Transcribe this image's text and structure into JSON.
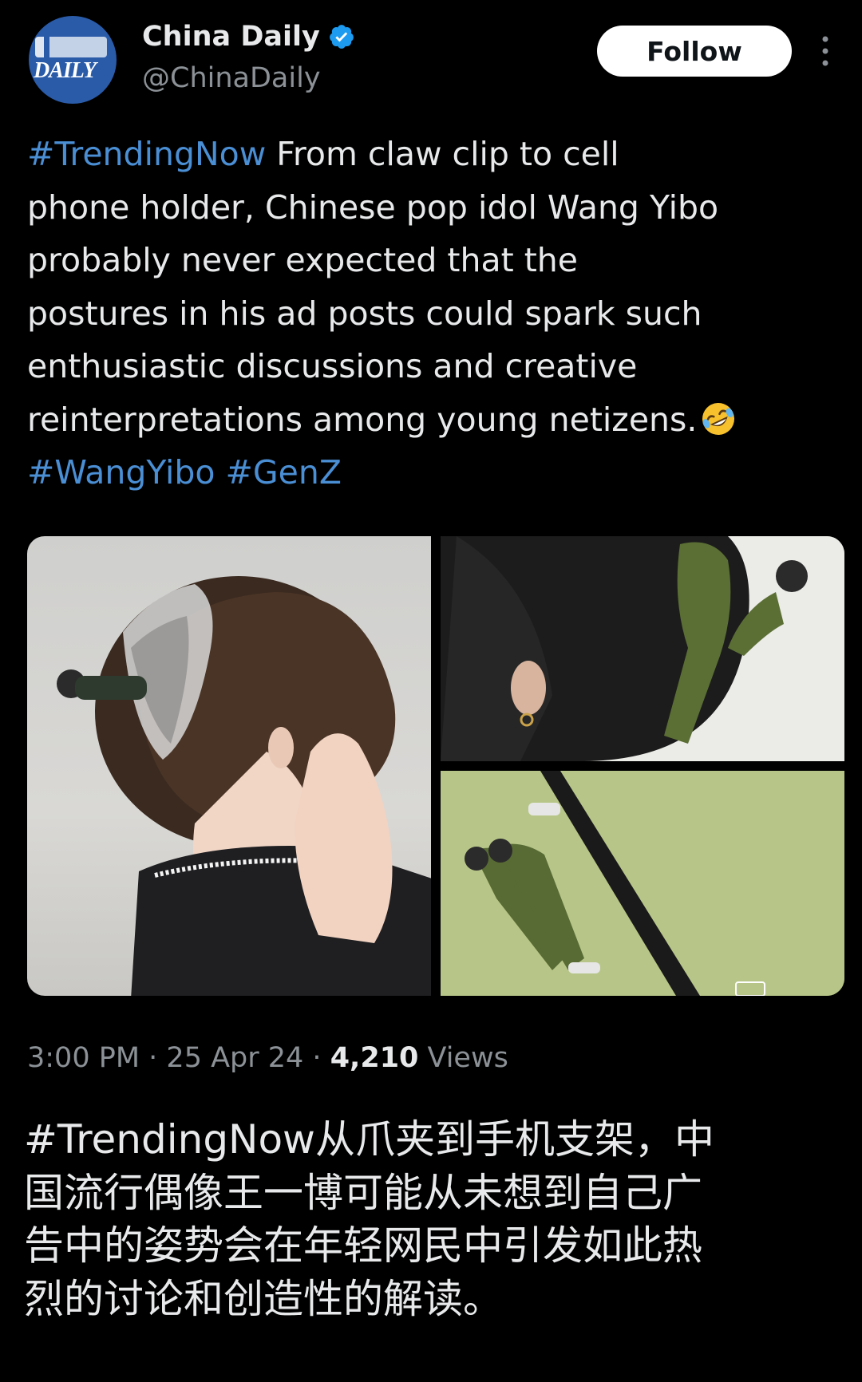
{
  "account": {
    "display_name": "China Daily",
    "handle": "@ChinaDaily",
    "avatar_text": "DAILY",
    "verified": true
  },
  "header": {
    "follow_label": "Follow",
    "more_icon": "more-vertical-icon"
  },
  "post": {
    "lines": [
      {
        "hashtag": "#TrendingNow",
        "text": " From claw clip to cell"
      },
      {
        "text": "phone holder, Chinese pop idol Wang Yibo"
      },
      {
        "text": "probably never expected that the"
      },
      {
        "text": "postures in his ad posts could spark such"
      },
      {
        "text": "enthusiastic discussions and creative"
      },
      {
        "text": "reinterpretations among young netizens."
      }
    ],
    "emoji": "rolling-on-floor-laughing-icon",
    "hashtags": [
      "#WangYibo",
      "#GenZ"
    ]
  },
  "media": [
    {
      "name": "claw-clip-photo",
      "icon": "photo"
    },
    {
      "name": "hair-clip-figure-photo",
      "icon": "photo"
    },
    {
      "name": "phone-holder-figure-photo",
      "icon": "photo"
    }
  ],
  "meta": {
    "time": "3:00 PM",
    "separator": " · ",
    "date": "25 Apr 24",
    "views_count": "4,210",
    "views_label": " Views"
  },
  "translation": {
    "lines": [
      "#TrendingNow从爪夹到手机支架，中",
      "国流行偶像王一博可能从未想到自己广",
      "告中的姿势会在年轻网民中引发如此热",
      "烈的讨论和创造性的解读。"
    ]
  },
  "colors": {
    "background": "#000000",
    "text": "#e7e9ea",
    "secondary": "#8b9196",
    "link": "#4a8ed4",
    "verified": "#1d9bf0",
    "follow_bg": "#ffffff"
  }
}
